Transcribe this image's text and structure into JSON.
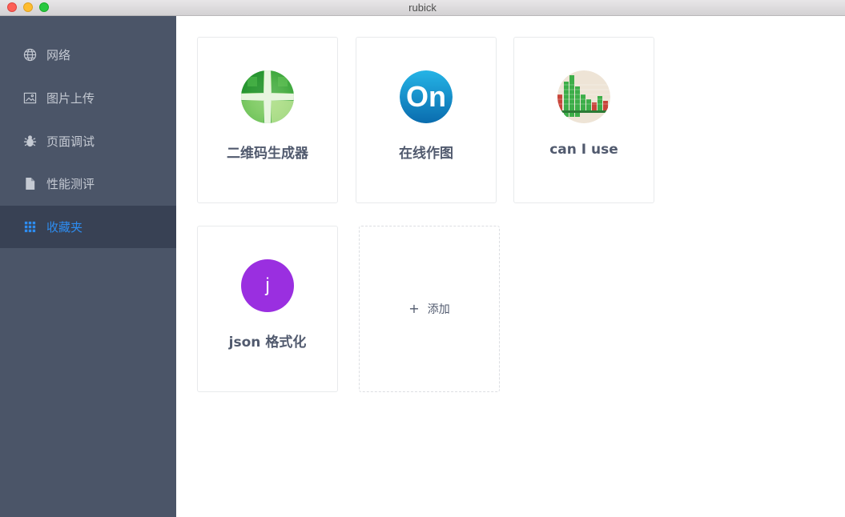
{
  "window": {
    "title": "rubick"
  },
  "sidebar": {
    "items": [
      {
        "label": "网络",
        "icon": "globe-icon"
      },
      {
        "label": "图片上传",
        "icon": "image-icon"
      },
      {
        "label": "页面调试",
        "icon": "bug-icon"
      },
      {
        "label": "性能测评",
        "icon": "file-icon"
      },
      {
        "label": "收藏夹",
        "icon": "grid-icon",
        "active": true
      }
    ]
  },
  "favorites": {
    "cards": [
      {
        "label": "二维码生成器",
        "icon": "qrcode-generator-icon"
      },
      {
        "label": "在线作图",
        "icon": "on-logo-icon",
        "logo_text": "On"
      },
      {
        "label": "can I use",
        "icon": "caniuse-icon"
      },
      {
        "label": "json 格式化",
        "icon": "json-avatar-icon",
        "avatar_text": "j"
      }
    ],
    "add_label": "添加",
    "add_symbol": "+"
  },
  "colors": {
    "sidebar_bg": "#4b5568",
    "active_bg": "#384154",
    "accent": "#2d8cf0",
    "json_avatar": "#9a2fe0"
  }
}
